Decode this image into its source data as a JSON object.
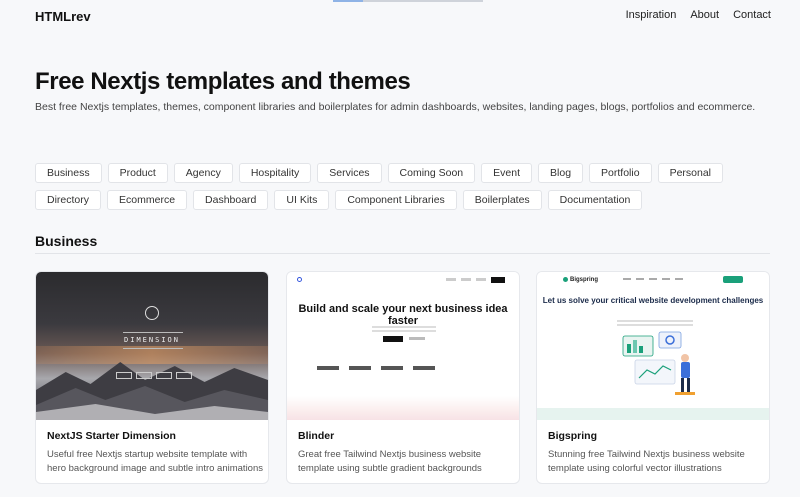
{
  "header": {
    "logo": "HTMLrev",
    "nav": [
      "Inspiration",
      "About",
      "Contact"
    ]
  },
  "hero": {
    "title": "Free Nextjs templates and themes",
    "subtitle": "Best free Nextjs templates, themes, component libraries and boilerplates for admin dashboards, websites, landing pages, blogs, portfolios and ecommerce."
  },
  "categories": [
    "Business",
    "Product",
    "Agency",
    "Hospitality",
    "Services",
    "Coming Soon",
    "Event",
    "Blog",
    "Portfolio",
    "Personal",
    "Directory",
    "Ecommerce",
    "Dashboard",
    "UI Kits",
    "Component Libraries",
    "Boilerplates",
    "Documentation"
  ],
  "section": {
    "title": "Business"
  },
  "cards": [
    {
      "title": "NextJS Starter Dimension",
      "description": "Useful free Nextjs startup website template with hero background image and subtle intro animations",
      "thumb_text": "DIMENSION"
    },
    {
      "title": "Blinder",
      "description": "Great free Tailwind Nextjs business website template using subtle gradient backgrounds",
      "thumb_text": "Build and scale your next business idea faster"
    },
    {
      "title": "Bigspring",
      "description": "Stunning free Tailwind Nextjs business website template using colorful vector illustrations",
      "thumb_text": "Let us solve your critical website development challenges",
      "thumb_logo": "Bigspring"
    }
  ],
  "colors": {
    "background": "#f7f8fa",
    "accent_green": "#1aa07a",
    "accent_blue": "#3355dd"
  }
}
